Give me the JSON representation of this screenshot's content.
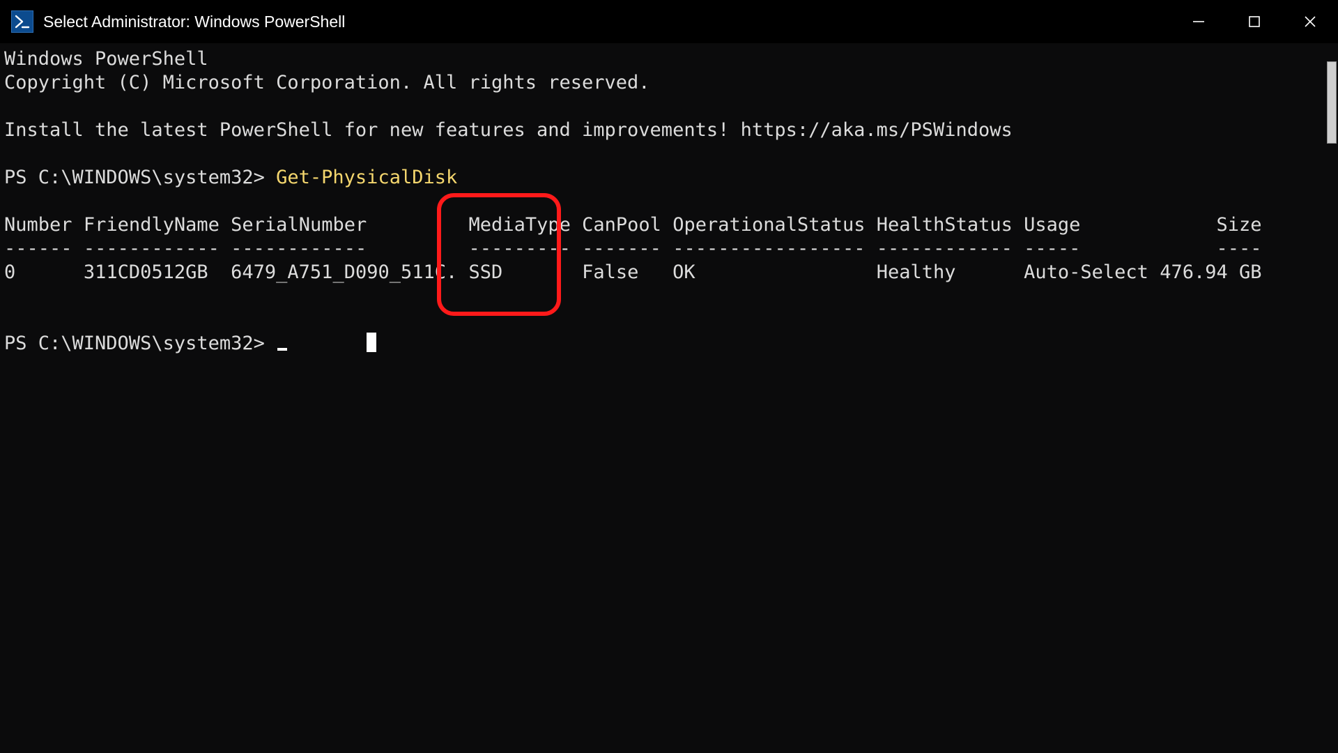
{
  "window": {
    "title": "Select Administrator: Windows PowerShell"
  },
  "terminal": {
    "line1": "Windows PowerShell",
    "line2": "Copyright (C) Microsoft Corporation. All rights reserved.",
    "install_msg": "Install the latest PowerShell for new features and improvements! https://aka.ms/PSWindows",
    "prompt1_prefix": "PS C:\\WINDOWS\\system32> ",
    "command1": "Get-PhysicalDisk",
    "prompt2": "PS C:\\WINDOWS\\system32> ",
    "table": {
      "headers": {
        "number": "Number",
        "friendly": "FriendlyName",
        "serial": "SerialNumber",
        "media": "MediaType",
        "canpool": "CanPool",
        "opstatus": "OperationalStatus",
        "health": "HealthStatus",
        "usage": "Usage",
        "size": "Size"
      },
      "dividers": {
        "number": "------",
        "friendly": "------------",
        "serial": "------------",
        "media": "---------",
        "canpool": "-------",
        "opstatus": "-----------------",
        "health": "------------",
        "usage": "-----",
        "size": "----"
      },
      "row": {
        "number": "0",
        "friendly": "311CD0512GB",
        "serial": "6479_A751_D090_511C.",
        "media": "SSD",
        "canpool": "False",
        "opstatus": "OK",
        "health": "Healthy",
        "usage": "Auto-Select",
        "size": "476.94 GB"
      }
    }
  },
  "annotation": {
    "highlighted_column": "MediaType"
  }
}
